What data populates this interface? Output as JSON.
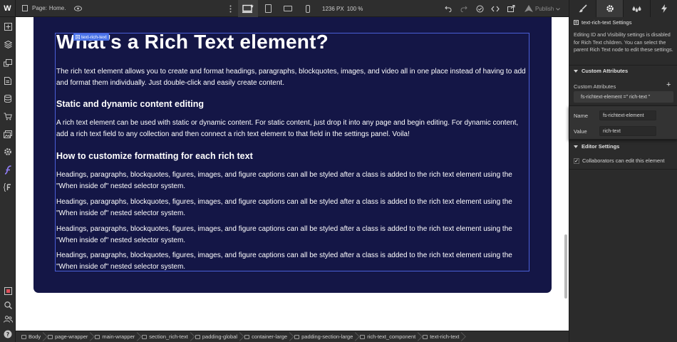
{
  "topbar": {
    "logo": "W",
    "page_label": "Page:",
    "page_name": "Home.",
    "canvas_width": "1236 PX",
    "zoom": "100 %",
    "publish_label": "Publish"
  },
  "canvas": {
    "selected_tag": "text-rich-text",
    "heading": "What’s a Rich Text element?",
    "intro": "The rich text element allows you to create and format headings, paragraphs, blockquotes, images, and video all in one place instead of having to add and format them individually. Just double-click and easily create content.",
    "section1_title": "Static and dynamic content editing",
    "section1_body": "A rich text element can be used with static or dynamic content. For static content, just drop it into any page and begin editing. For dynamic content, add a rich text field to any collection and then connect a rich text element to that field in the settings panel. Voila!",
    "section2_title": "How to customize formatting for each rich text",
    "section2_body": "Headings, paragraphs, blockquotes, figures, images, and figure captions can all be styled after a class is added to the rich text element using the \"When inside of\" nested selector system."
  },
  "breadcrumbs": [
    "Body",
    "page-wrapper",
    "main-wrapper",
    "section_rich-text",
    "padding-global",
    "container-large",
    "padding-section-large",
    "rich-text_component",
    "text-rich-text"
  ],
  "panel": {
    "title": "text-rich-text Settings",
    "note": "Editing ID and Visibility settings is disabled for Rich Text children. You can select the parent Rich Text node to edit these settings.",
    "custom_attributes_heading": "Custom Attributes",
    "custom_attributes_label": "Custom Attributes",
    "attribute_chip": "fs-richtext-element =\" rich-text \"",
    "name_label": "Name",
    "name_value": "fs-richtext-element",
    "value_label": "Value",
    "value_value": "rich-text",
    "editor_settings_heading": "Editor Settings",
    "collaborators_label": "Collaborators can edit this element"
  }
}
